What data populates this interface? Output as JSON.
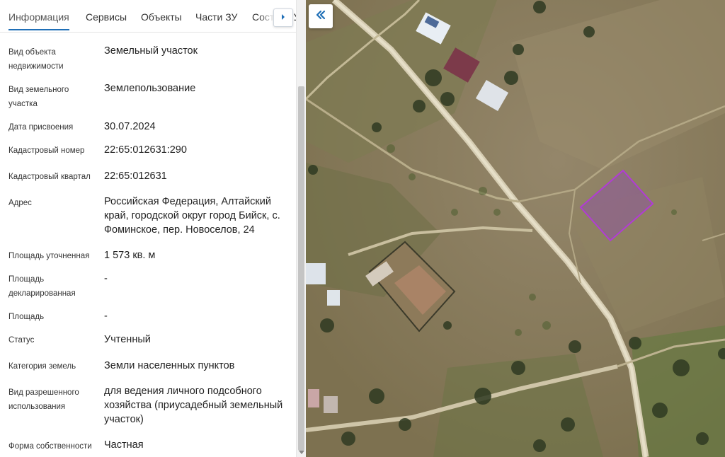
{
  "tabs": [
    {
      "label": "Информация",
      "active": true
    },
    {
      "label": "Сервисы"
    },
    {
      "label": "Объекты"
    },
    {
      "label": "Части ЗУ"
    },
    {
      "label": "Состав ЗУ"
    }
  ],
  "properties": [
    {
      "label": "Вид объекта недвижимости",
      "value": "Земельный участок"
    },
    {
      "label": "Вид земельного участка",
      "value": "Землепользование"
    },
    {
      "label": "Дата присвоения",
      "value": "30.07.2024"
    },
    {
      "label": "Кадастровый номер",
      "value": "22:65:012631:290"
    },
    {
      "label": "Кадастровый квартал",
      "value": "22:65:012631"
    },
    {
      "label": "Адрес",
      "value": "Российская Федерация, Алтайский край, городской округ город Бийск, с. Фоминское, пер. Новоселов, 24"
    },
    {
      "label": "Площадь уточненная",
      "value": "1 573 кв. м"
    },
    {
      "label": "Площадь декларированная",
      "value": "-"
    },
    {
      "label": "Площадь",
      "value": "-"
    },
    {
      "label": "Статус",
      "value": "Учтенный"
    },
    {
      "label": "Категория земель",
      "value": "Земли населенных пунктов"
    },
    {
      "label": "Вид разрешенного использования",
      "value": "для ведения личного подсобного хозяйства (приусадебный земельный участок)"
    },
    {
      "label": "Форма собственности",
      "value": "Частная"
    }
  ],
  "icons": {
    "tab_next": "chevron-right-icon",
    "collapse": "double-chevron-left-icon"
  },
  "colors": {
    "accent": "#1f6fb7",
    "parcel_outline": "#b23bd6",
    "parcel_fill": "#8e3fbf"
  }
}
